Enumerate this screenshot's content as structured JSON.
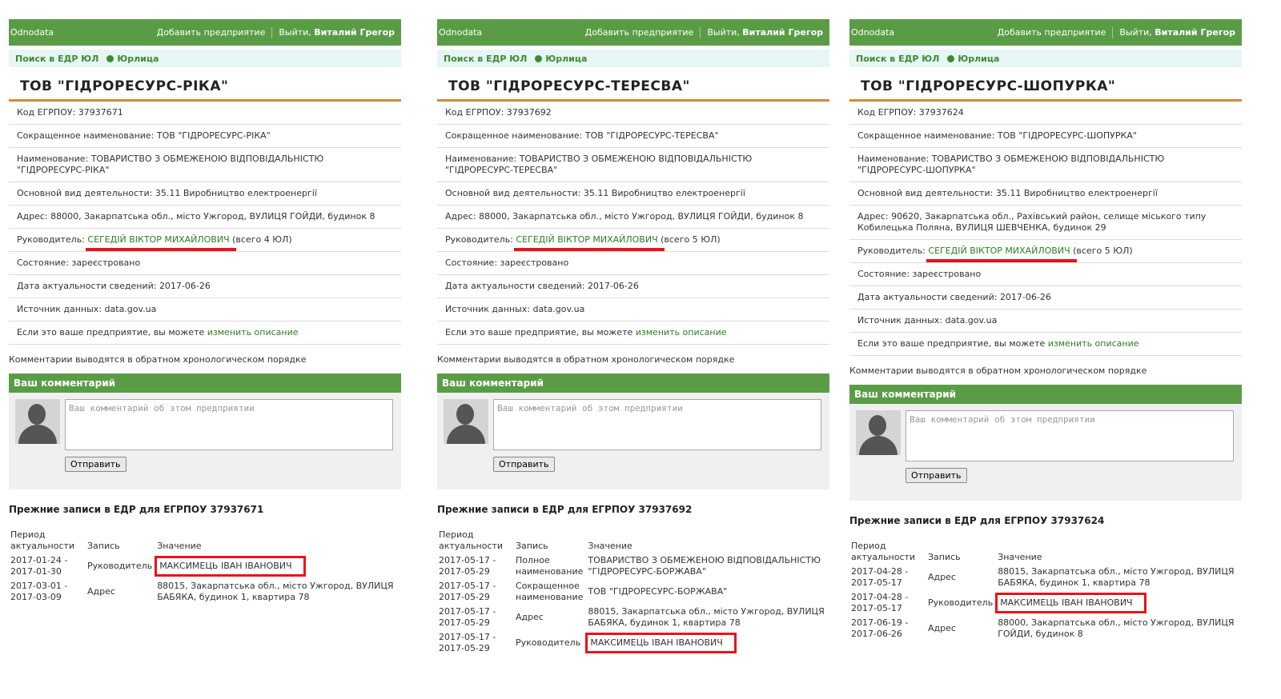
{
  "brand": "Odnodata",
  "nav": {
    "add": "Добавить предприятие",
    "logout": "Выйти,",
    "user": "Виталий Грегор"
  },
  "subnav": {
    "search": "Поиск в ЕДР ЮЛ",
    "forum": "Юрлица"
  },
  "labels": {
    "code": "Код ЕГРПОУ:",
    "short": "Сокращенное наименование:",
    "full": "Наименование:",
    "activity": "Основной вид деятельности:",
    "address": "Адрес:",
    "head": "Руководитель:",
    "state": "Состояние:",
    "date": "Дата актуальности сведений:",
    "source": "Источник данных:",
    "edit_prefix": "Если это ваше предприятие, вы можете",
    "edit_link": "изменить описание",
    "comments_note": "Комментарии выводятся в обратном хронологическом порядке",
    "your_comment": "Ваш комментарий",
    "placeholder": "Ваш комментарий об этом предприятии",
    "send": "Отправить",
    "prev_prefix": "Прежние записи в ЕДР для ЕГРПОУ",
    "col_period": "Период актуальности",
    "col_record": "Запись",
    "col_value": "Значение"
  },
  "panels": [
    {
      "title": "ТОВ \"ГІДРОРЕСУРС-РІКА\"",
      "code": "37937671",
      "short": "ТОВ \"ГІДРОРЕСУРС-РІКА\"",
      "full": "ТОВАРИСТВО З ОБМЕЖЕНОЮ ВІДПОВІДАЛЬНІСТЮ \"ГІДРОРЕСУРС-РІКА\"",
      "activity": "35.11 Виробництво електроенергії",
      "address": "88000, Закарпатська обл., місто Ужгород, ВУЛИЦЯ ГОЙДИ, будинок 8",
      "head": "СЕГЕДІЙ ВІКТОР МИХАЙЛОВИЧ",
      "head_count": "(всего 4 ЮЛ)",
      "state": "зареєстровано",
      "date": "2017-06-26",
      "source": "data.gov.ua",
      "history": [
        {
          "period": "2017-01-24 - 2017-01-30",
          "record": "Руководитель",
          "value": "МАКСИМЕЦЬ ІВАН ІВАНОВИЧ",
          "highlight": true
        },
        {
          "period": "2017-03-01 - 2017-03-09",
          "record": "Адрес",
          "value": "88015, Закарпатська обл., місто Ужгород, ВУЛИЦЯ БАБЯКА, будинок 1, квартира 78",
          "highlight": false
        }
      ]
    },
    {
      "title": "ТОВ \"ГІДРОРЕСУРС-ТЕРЕСВА\"",
      "code": "37937692",
      "short": "ТОВ \"ГІДРОРЕСУРС-ТЕРЕСВА\"",
      "full": "ТОВАРИСТВО З ОБМЕЖЕНОЮ ВІДПОВІДАЛЬНІСТЮ \"ГІДРОРЕСУРС-ТЕРЕСВА\"",
      "activity": "35.11 Виробництво електроенергії",
      "address": "88000, Закарпатська обл., місто Ужгород, ВУЛИЦЯ ГОЙДИ, будинок 8",
      "head": "СЕГЕДІЙ ВІКТОР МИХАЙЛОВИЧ",
      "head_count": "(всего 5 ЮЛ)",
      "state": "зареєстровано",
      "date": "2017-06-26",
      "source": "data.gov.ua",
      "history": [
        {
          "period": "2017-05-17 - 2017-05-29",
          "record": "Полное наименование",
          "value": "ТОВАРИСТВО З ОБМЕЖЕНОЮ ВІДПОВІДАЛЬНІСТЮ \"ГІДРОРЕСУРС-БОРЖАВА\"",
          "highlight": false
        },
        {
          "period": "2017-05-17 - 2017-05-29",
          "record": "Сокращенное наименование",
          "value": "ТОВ \"ГІДРОРЕСУРС-БОРЖАВА\"",
          "highlight": false
        },
        {
          "period": "2017-05-17 - 2017-05-29",
          "record": "Адрес",
          "value": "88015, Закарпатська обл., місто Ужгород, ВУЛИЦЯ БАБЯКА, будинок 1, квартира 78",
          "highlight": false
        },
        {
          "period": "2017-05-17 - 2017-05-29",
          "record": "Руководитель",
          "value": "МАКСИМЕЦЬ ІВАН ІВАНОВИЧ",
          "highlight": true
        }
      ]
    },
    {
      "title": "ТОВ \"ГІДРОРЕСУРС-ШОПУРКА\"",
      "code": "37937624",
      "short": "ТОВ \"ГІДРОРЕСУРС-ШОПУРКА\"",
      "full": "ТОВАРИСТВО З ОБМЕЖЕНОЮ ВІДПОВІДАЛЬНІСТЮ \"ГІДРОРЕСУРС-ШОПУРКА\"",
      "activity": "35.11 Виробництво електроенергії",
      "address": "90620, Закарпатська обл., Рахівський район, селище міського типу Кобилецька Поляна, ВУЛИЦЯ ШЕВЧЕНКА, будинок 29",
      "head": "СЕГЕДІЙ ВІКТОР МИХАЙЛОВИЧ",
      "head_count": "(всего 5 ЮЛ)",
      "state": "зареєстровано",
      "date": "2017-06-26",
      "source": "data.gov.ua",
      "history": [
        {
          "period": "2017-04-28 - 2017-05-17",
          "record": "Адрес",
          "value": "88015, Закарпатська обл., місто Ужгород, ВУЛИЦЯ БАБЯКА, будинок 1, квартира 78",
          "highlight": false
        },
        {
          "period": "2017-04-28 - 2017-05-17",
          "record": "Руководитель",
          "value": "МАКСИМЕЦЬ ІВАН ІВАНОВИЧ",
          "highlight": true
        },
        {
          "period": "2017-06-19 - 2017-06-26",
          "record": "Адрес",
          "value": "88000, Закарпатська обл., місто Ужгород, ВУЛИЦЯ ГОЙДИ, будинок 8",
          "highlight": false
        }
      ]
    }
  ]
}
